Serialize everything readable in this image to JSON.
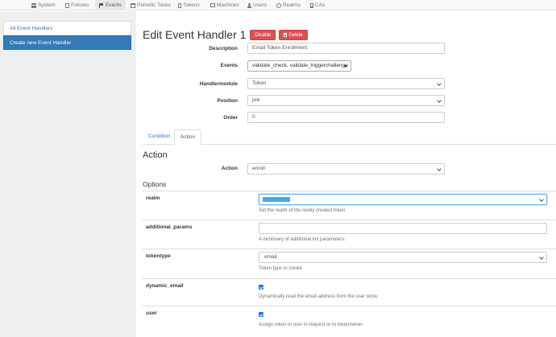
{
  "nav": {
    "items": [
      {
        "label": "System",
        "icon": "server-icon"
      },
      {
        "label": "Policies",
        "icon": "document-icon"
      },
      {
        "label": "Events",
        "icon": "flag-icon",
        "active": true
      },
      {
        "label": "Periodic Tasks",
        "icon": "calendar-icon"
      },
      {
        "label": "Tokens",
        "icon": "phone-icon"
      },
      {
        "label": "Machines",
        "icon": "hdd-icon"
      },
      {
        "label": "Users",
        "icon": "user-icon"
      },
      {
        "label": "Realms",
        "icon": "globe-icon"
      },
      {
        "label": "CAs",
        "icon": "book-icon"
      }
    ]
  },
  "sidebar": {
    "items": [
      {
        "label": "All Event Handlers"
      },
      {
        "label": "Create new Event Handler",
        "active": true
      }
    ]
  },
  "header": {
    "title": "Edit Event Handler 1",
    "disable_label": "Disable",
    "delete_label": "Delete"
  },
  "form": {
    "description": {
      "label": "Description",
      "value": "Email Token Enrollment"
    },
    "events": {
      "label": "Events",
      "value": "validate_check,  validate_triggerchallenge"
    },
    "handlermodule": {
      "label": "Handlermodule",
      "value": "Token"
    },
    "position": {
      "label": "Position",
      "value": "pre"
    },
    "order": {
      "label": "Order",
      "value": "0"
    }
  },
  "tabs": [
    {
      "label": "Condition"
    },
    {
      "label": "Action",
      "active": true
    }
  ],
  "action": {
    "heading": "Action",
    "label": "Action",
    "value": "enroll"
  },
  "options": {
    "heading": "Options",
    "realm": {
      "name": "realm",
      "value": "",
      "help": "Set the realm of the newly created token."
    },
    "additional_params": {
      "name": "additional_params",
      "value": "",
      "help": "A dictionary of additional init parameters."
    },
    "tokentype": {
      "name": "tokentype",
      "value": "email",
      "help": "Token type to create"
    },
    "dynamic_email": {
      "name": "dynamic_email",
      "checked": true,
      "help": "Dynamically read the email address from the user store."
    },
    "user": {
      "name": "user",
      "checked": true,
      "help": "Assign token to user in request or to tokenowner."
    }
  },
  "colors": {
    "primary": "#337ab7",
    "danger": "#d9534f",
    "checkbox": "#1a73e8"
  }
}
